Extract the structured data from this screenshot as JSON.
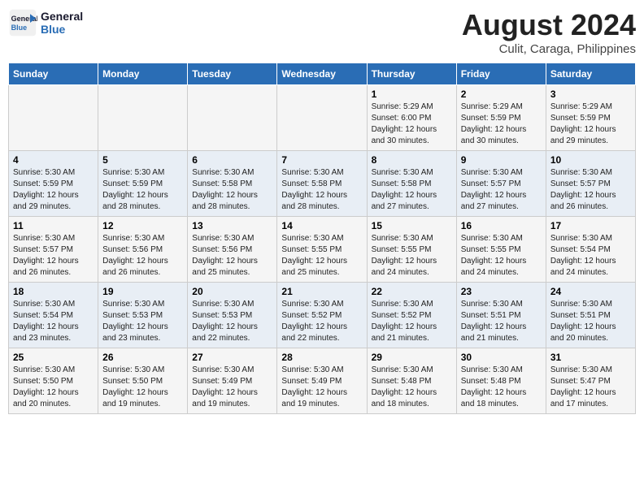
{
  "header": {
    "logo_line1": "General",
    "logo_line2": "Blue",
    "month": "August 2024",
    "location": "Culit, Caraga, Philippines"
  },
  "days_of_week": [
    "Sunday",
    "Monday",
    "Tuesday",
    "Wednesday",
    "Thursday",
    "Friday",
    "Saturday"
  ],
  "weeks": [
    [
      {
        "day": "",
        "info": ""
      },
      {
        "day": "",
        "info": ""
      },
      {
        "day": "",
        "info": ""
      },
      {
        "day": "",
        "info": ""
      },
      {
        "day": "1",
        "info": "Sunrise: 5:29 AM\nSunset: 6:00 PM\nDaylight: 12 hours\nand 30 minutes."
      },
      {
        "day": "2",
        "info": "Sunrise: 5:29 AM\nSunset: 5:59 PM\nDaylight: 12 hours\nand 30 minutes."
      },
      {
        "day": "3",
        "info": "Sunrise: 5:29 AM\nSunset: 5:59 PM\nDaylight: 12 hours\nand 29 minutes."
      }
    ],
    [
      {
        "day": "4",
        "info": "Sunrise: 5:30 AM\nSunset: 5:59 PM\nDaylight: 12 hours\nand 29 minutes."
      },
      {
        "day": "5",
        "info": "Sunrise: 5:30 AM\nSunset: 5:59 PM\nDaylight: 12 hours\nand 28 minutes."
      },
      {
        "day": "6",
        "info": "Sunrise: 5:30 AM\nSunset: 5:58 PM\nDaylight: 12 hours\nand 28 minutes."
      },
      {
        "day": "7",
        "info": "Sunrise: 5:30 AM\nSunset: 5:58 PM\nDaylight: 12 hours\nand 28 minutes."
      },
      {
        "day": "8",
        "info": "Sunrise: 5:30 AM\nSunset: 5:58 PM\nDaylight: 12 hours\nand 27 minutes."
      },
      {
        "day": "9",
        "info": "Sunrise: 5:30 AM\nSunset: 5:57 PM\nDaylight: 12 hours\nand 27 minutes."
      },
      {
        "day": "10",
        "info": "Sunrise: 5:30 AM\nSunset: 5:57 PM\nDaylight: 12 hours\nand 26 minutes."
      }
    ],
    [
      {
        "day": "11",
        "info": "Sunrise: 5:30 AM\nSunset: 5:57 PM\nDaylight: 12 hours\nand 26 minutes."
      },
      {
        "day": "12",
        "info": "Sunrise: 5:30 AM\nSunset: 5:56 PM\nDaylight: 12 hours\nand 26 minutes."
      },
      {
        "day": "13",
        "info": "Sunrise: 5:30 AM\nSunset: 5:56 PM\nDaylight: 12 hours\nand 25 minutes."
      },
      {
        "day": "14",
        "info": "Sunrise: 5:30 AM\nSunset: 5:55 PM\nDaylight: 12 hours\nand 25 minutes."
      },
      {
        "day": "15",
        "info": "Sunrise: 5:30 AM\nSunset: 5:55 PM\nDaylight: 12 hours\nand 24 minutes."
      },
      {
        "day": "16",
        "info": "Sunrise: 5:30 AM\nSunset: 5:55 PM\nDaylight: 12 hours\nand 24 minutes."
      },
      {
        "day": "17",
        "info": "Sunrise: 5:30 AM\nSunset: 5:54 PM\nDaylight: 12 hours\nand 24 minutes."
      }
    ],
    [
      {
        "day": "18",
        "info": "Sunrise: 5:30 AM\nSunset: 5:54 PM\nDaylight: 12 hours\nand 23 minutes."
      },
      {
        "day": "19",
        "info": "Sunrise: 5:30 AM\nSunset: 5:53 PM\nDaylight: 12 hours\nand 23 minutes."
      },
      {
        "day": "20",
        "info": "Sunrise: 5:30 AM\nSunset: 5:53 PM\nDaylight: 12 hours\nand 22 minutes."
      },
      {
        "day": "21",
        "info": "Sunrise: 5:30 AM\nSunset: 5:52 PM\nDaylight: 12 hours\nand 22 minutes."
      },
      {
        "day": "22",
        "info": "Sunrise: 5:30 AM\nSunset: 5:52 PM\nDaylight: 12 hours\nand 21 minutes."
      },
      {
        "day": "23",
        "info": "Sunrise: 5:30 AM\nSunset: 5:51 PM\nDaylight: 12 hours\nand 21 minutes."
      },
      {
        "day": "24",
        "info": "Sunrise: 5:30 AM\nSunset: 5:51 PM\nDaylight: 12 hours\nand 20 minutes."
      }
    ],
    [
      {
        "day": "25",
        "info": "Sunrise: 5:30 AM\nSunset: 5:50 PM\nDaylight: 12 hours\nand 20 minutes."
      },
      {
        "day": "26",
        "info": "Sunrise: 5:30 AM\nSunset: 5:50 PM\nDaylight: 12 hours\nand 19 minutes."
      },
      {
        "day": "27",
        "info": "Sunrise: 5:30 AM\nSunset: 5:49 PM\nDaylight: 12 hours\nand 19 minutes."
      },
      {
        "day": "28",
        "info": "Sunrise: 5:30 AM\nSunset: 5:49 PM\nDaylight: 12 hours\nand 19 minutes."
      },
      {
        "day": "29",
        "info": "Sunrise: 5:30 AM\nSunset: 5:48 PM\nDaylight: 12 hours\nand 18 minutes."
      },
      {
        "day": "30",
        "info": "Sunrise: 5:30 AM\nSunset: 5:48 PM\nDaylight: 12 hours\nand 18 minutes."
      },
      {
        "day": "31",
        "info": "Sunrise: 5:30 AM\nSunset: 5:47 PM\nDaylight: 12 hours\nand 17 minutes."
      }
    ]
  ]
}
